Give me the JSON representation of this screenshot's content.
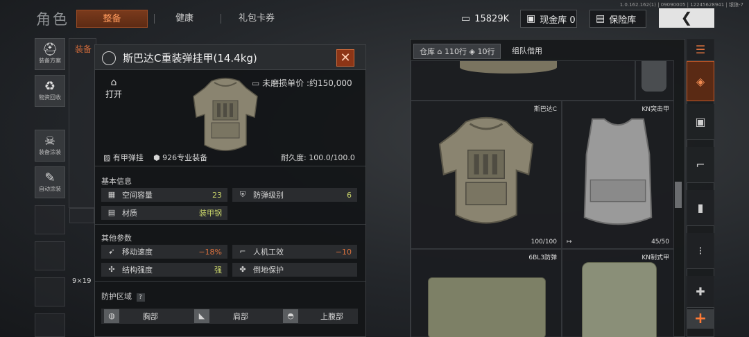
{
  "header": {
    "page_title": "角色",
    "tabs": [
      {
        "label": "整备",
        "active": true
      },
      {
        "label": "健康",
        "active": false
      },
      {
        "label": "礼包卡券",
        "active": false
      }
    ],
    "version": "1.0.162.162(1) | 09090005 | 12245628941 | 银狼-7",
    "money": "15829K",
    "cash_vault": "现金库 0",
    "safe_vault": "保险库",
    "back_icon": "chevron-left-icon"
  },
  "left_menu": [
    {
      "label": "装备方案",
      "icon": "loadout-icon"
    },
    {
      "label": "物资回收",
      "icon": "recycle-icon"
    },
    {
      "label": "装备涂装",
      "icon": "paint-icon"
    },
    {
      "label": "自动涂装",
      "icon": "auto-paint-icon"
    }
  ],
  "left_bg": {
    "header_text": "装备",
    "ammo_label": "9×19"
  },
  "popup": {
    "title": "斯巴达C重装弹挂甲(14.4kg)",
    "open_label": "打开",
    "price_label": "未磨损单价 :约150,000",
    "tag_type": "有甲弹挂",
    "tag_pro": "926专业装备",
    "durability": "耐久度: 100.0/100.0",
    "basic_info_title": "基本信息",
    "basic_stats": [
      {
        "label": "空间容量",
        "value": "23",
        "icon": "backpack-icon",
        "color": "#c8d36a"
      },
      {
        "label": "防弹级别",
        "value": "6",
        "icon": "shield-icon",
        "color": "#c8d36a"
      },
      {
        "label": "材质",
        "value": "装甲钢",
        "icon": "material-icon",
        "color": "#c8d36a"
      }
    ],
    "other_params_title": "其他参数",
    "other_stats": [
      {
        "label": "移动速度",
        "value": "−18%",
        "icon": "run-icon",
        "color": "#e0733e"
      },
      {
        "label": "人机工效",
        "value": "−10",
        "icon": "gun-icon",
        "color": "#e0733e"
      },
      {
        "label": "结构强度",
        "value": "强",
        "icon": "structure-icon",
        "color": "#c8d36a"
      },
      {
        "label": "倒地保护",
        "value": "",
        "icon": "protection-icon",
        "color": "#c8d36a"
      }
    ],
    "zone_title": "防护区域",
    "zone_help": "?",
    "zones": [
      {
        "label": "胸部",
        "icon": "chest-icon"
      },
      {
        "label": "肩部",
        "icon": "shoulder-icon"
      },
      {
        "label": "上腹部",
        "icon": "abdomen-icon"
      }
    ]
  },
  "storage": {
    "tab_label": "仓库",
    "rows_a": "110行",
    "rows_b": "10行",
    "team_tab": "组队借用",
    "items": [
      {
        "name": "斯巴达C",
        "status": "100/100"
      },
      {
        "name": "KN突击甲",
        "status": "45/50"
      },
      {
        "name": "6BL3防弹",
        "status": ""
      },
      {
        "name": "KN制式甲",
        "status": ""
      }
    ]
  },
  "right_sidebar": [
    {
      "icon": "layers-icon"
    },
    {
      "icon": "armor-rig-icon"
    },
    {
      "icon": "vest-icon"
    },
    {
      "icon": "rifle-icon"
    },
    {
      "icon": "magazine-icon"
    },
    {
      "icon": "ammo-icon"
    },
    {
      "icon": "medkit-icon"
    },
    {
      "icon": "add-icon",
      "label": "+"
    }
  ]
}
